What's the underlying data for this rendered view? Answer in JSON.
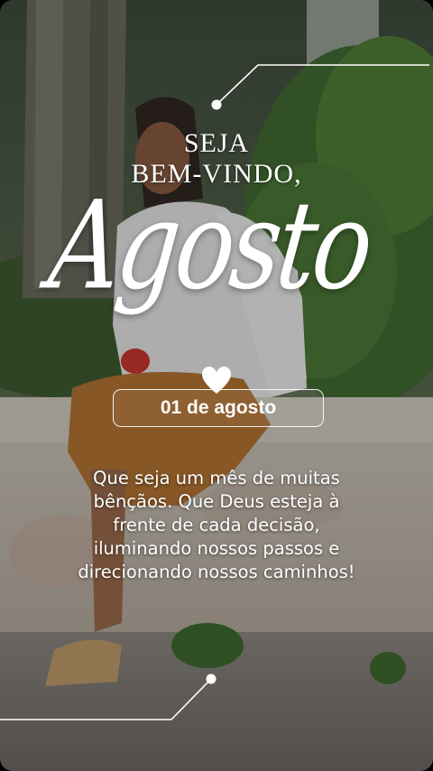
{
  "story": {
    "greeting_line1": "SEJA",
    "greeting_line2": "BEM-VINDO,",
    "month_script": "Agosto",
    "date": "01 de agosto",
    "message": "Que seja um mês de muitas bênçãos. Que Deus esteja à frente de cada decisão, iluminando nossos passos e direcionando nossos caminhos!"
  },
  "icons": {
    "heart": "heart-icon"
  },
  "colors": {
    "text": "#ffffff",
    "overlay": "rgba(20,20,20,0.30)"
  }
}
